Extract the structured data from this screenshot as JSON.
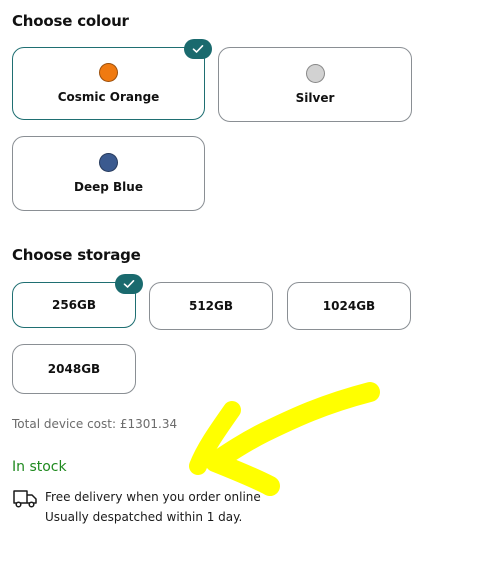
{
  "colour": {
    "heading": "Choose colour",
    "options": [
      {
        "label": "Cosmic Orange",
        "color": "#f07a10",
        "selected": true
      },
      {
        "label": "Silver",
        "color": "#d2d2d2",
        "selected": false
      },
      {
        "label": "Deep Blue",
        "color": "#3b5a8f",
        "selected": false
      }
    ]
  },
  "storage": {
    "heading": "Choose storage",
    "options": [
      {
        "label": "256GB",
        "selected": true
      },
      {
        "label": "512GB",
        "selected": false
      },
      {
        "label": "1024GB",
        "selected": false
      },
      {
        "label": "2048GB",
        "selected": false
      }
    ]
  },
  "cost": {
    "text": "Total device cost: £1301.34"
  },
  "stock": {
    "text": "In stock",
    "color": "#1f8a1f"
  },
  "delivery": {
    "icon": "delivery-truck-icon",
    "line1": "Free delivery when you order online",
    "line2": "Usually despatched within 1 day."
  },
  "theme": {
    "accent": "#1a6a6e",
    "annotation": "#ffff00"
  }
}
